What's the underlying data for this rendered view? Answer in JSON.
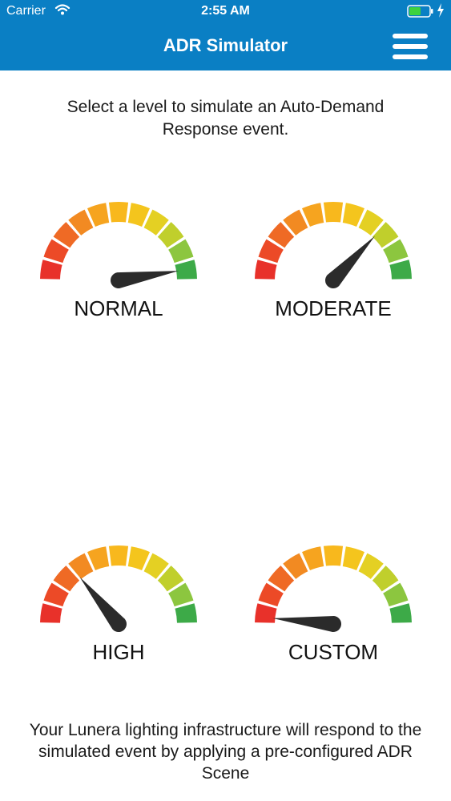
{
  "status_bar": {
    "carrier": "Carrier",
    "time": "2:55 AM"
  },
  "nav": {
    "title": "ADR Simulator",
    "menu_icon": "hamburger-menu-icon"
  },
  "intro_text": "Select a level to simulate an Auto-Demand Response event.",
  "gauges": [
    {
      "label": "NORMAL",
      "level": 0.95
    },
    {
      "label": "MODERATE",
      "level": 0.74
    },
    {
      "label": "HIGH",
      "level": 0.28
    },
    {
      "label": "CUSTOM",
      "level": 0.03
    }
  ],
  "gauge_colors": [
    "#e8312a",
    "#ec4a27",
    "#ef6a25",
    "#f28a22",
    "#f6a41f",
    "#f8b81d",
    "#f4c51d",
    "#e4d023",
    "#c0cf2c",
    "#8cc63f",
    "#3daa48"
  ],
  "needle_color": "#2b2b2b",
  "footer_text": "Your Lunera lighting infrastructure will respond to the simulated event by applying a pre-configured ADR Scene",
  "colors": {
    "header_bg": "#0a7fc4",
    "header_text": "#ffffff"
  }
}
